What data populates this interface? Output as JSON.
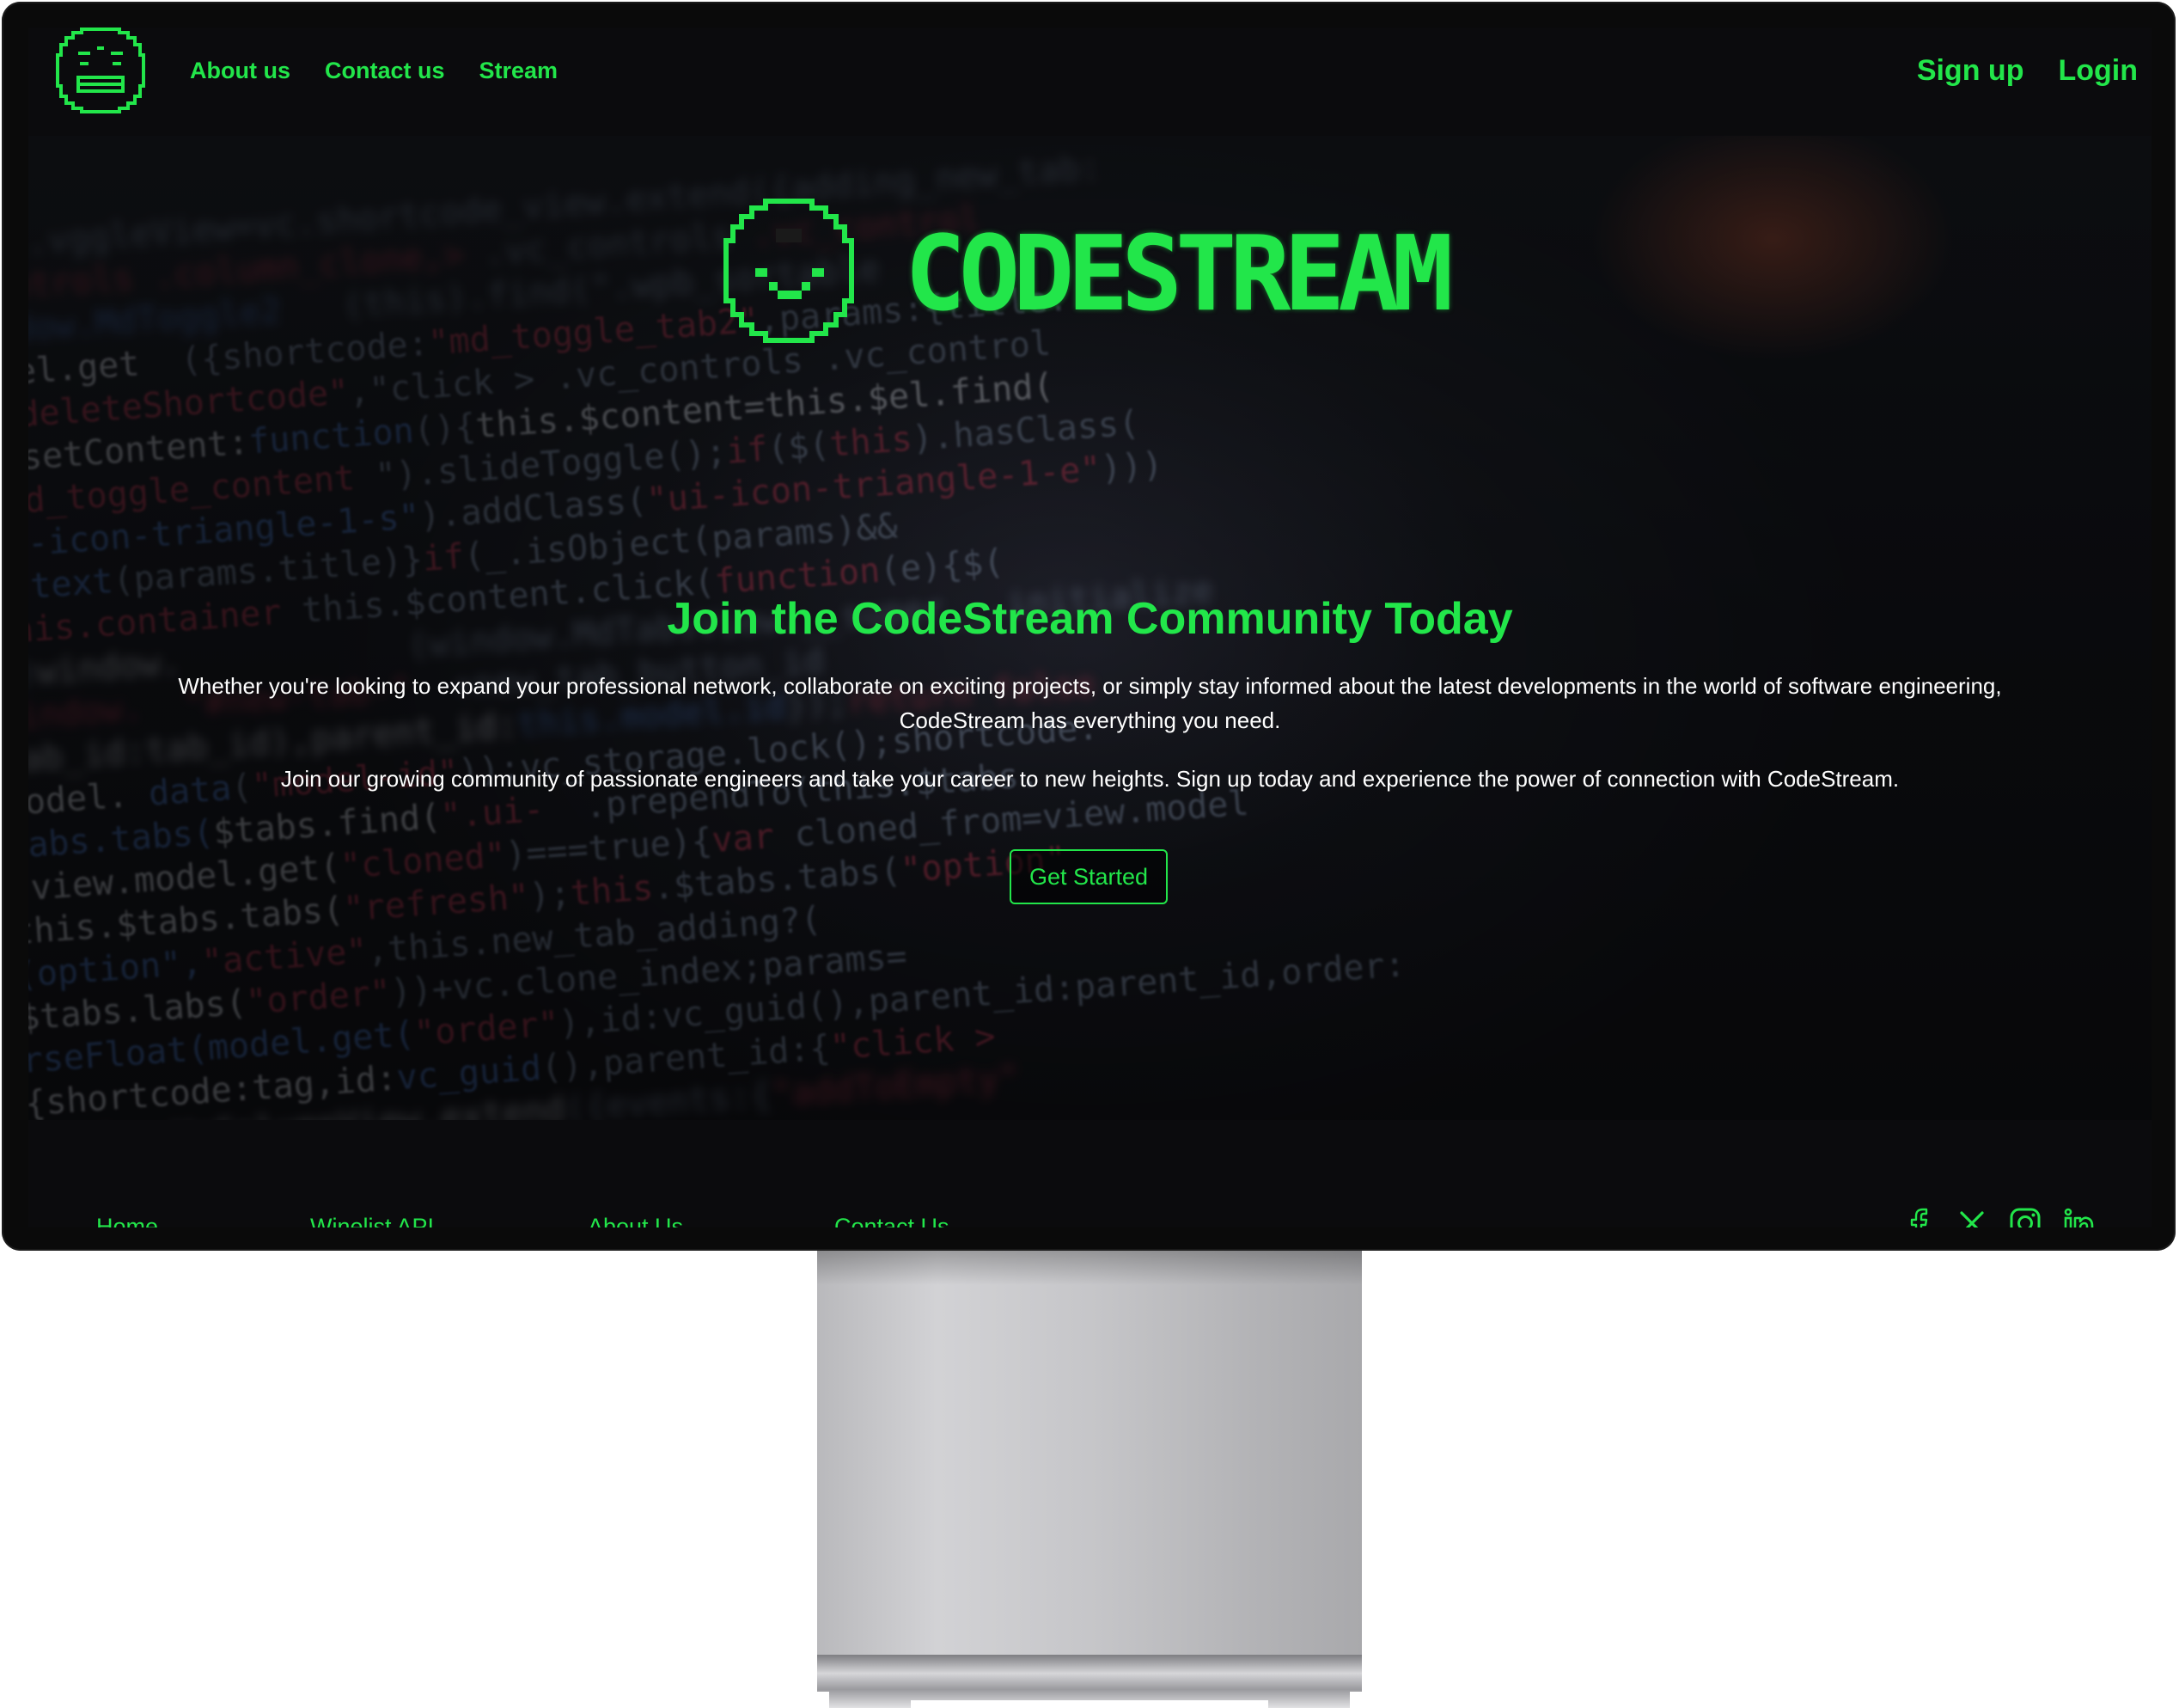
{
  "navbar": {
    "links": [
      "About us",
      "Contact us",
      "Stream"
    ],
    "signup": "Sign up",
    "login": "Login"
  },
  "hero": {
    "brand": "CODESTREAM",
    "title": "Join the CodeStream Community Today",
    "paragraph1": "Whether you're looking to expand your professional network, collaborate on exciting projects, or simply stay informed about the latest developments in the world of software engineering, CodeStream has everything you need.",
    "paragraph2": "Join our growing community of passionate engineers and take your career to new heights. Sign up today and experience the power of connection with CodeStream.",
    "cta": "Get Started"
  },
  "footer": {
    "links": [
      "Home",
      "Winelist API",
      "About Us",
      "Contact Us"
    ],
    "social_icons": [
      "facebook-icon",
      "x-icon",
      "instagram-icon",
      "linkedin-icon"
    ]
  },
  "colors": {
    "accent": "#22e64a",
    "background": "#0b0b0d",
    "text": "#ffffff"
  }
}
